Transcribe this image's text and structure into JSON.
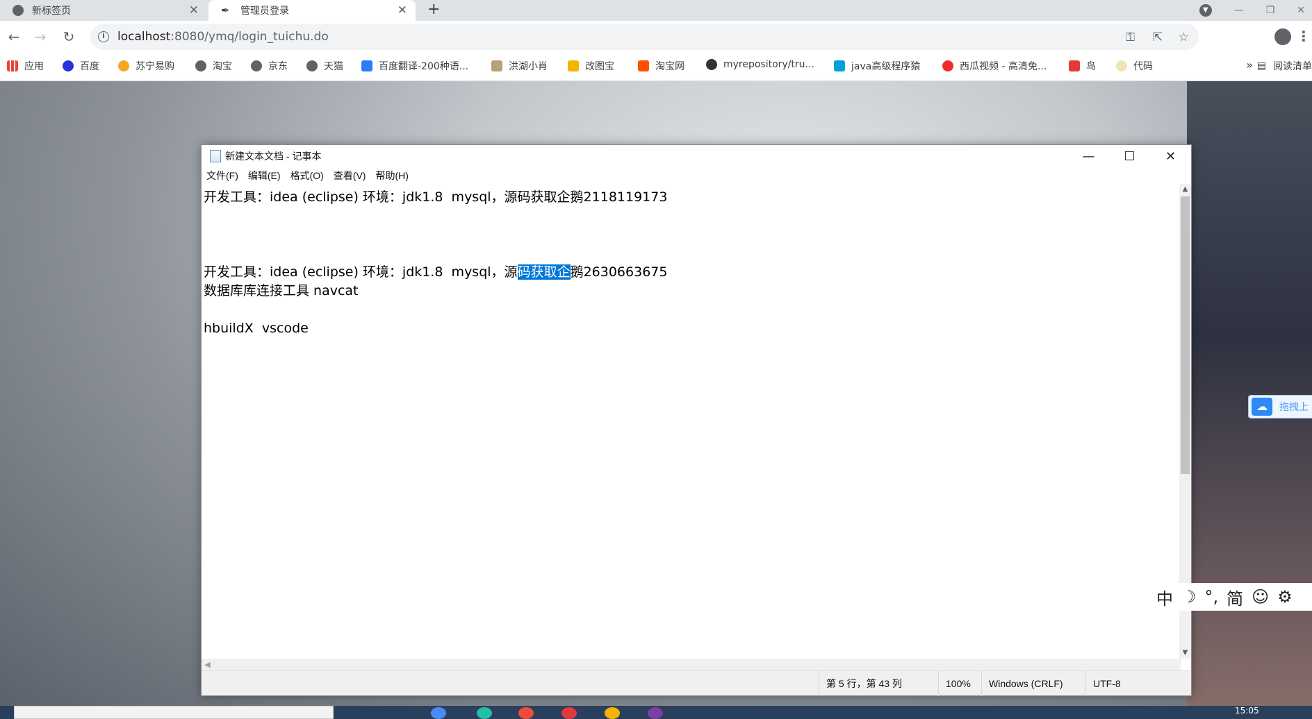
{
  "browser": {
    "tabs": [
      {
        "title": "新标签页",
        "active": false
      },
      {
        "title": "管理员登录",
        "active": true
      }
    ],
    "new_tab_label": "+",
    "url_host": "localhost",
    "url_rest": ":8080/ymq/login_tuichu.do",
    "bookmarks": [
      {
        "label": "应用",
        "icon": "apps-grid-icon",
        "color": "#1a73e8"
      },
      {
        "label": "百度",
        "icon": "baidu-paw-icon",
        "color": "#2932e1"
      },
      {
        "label": "苏宁易购",
        "icon": "suning-icon",
        "color": "#f5a623"
      },
      {
        "label": "淘宝",
        "icon": "globe-icon",
        "color": "#5f6368"
      },
      {
        "label": "京东",
        "icon": "globe-icon",
        "color": "#5f6368"
      },
      {
        "label": "天猫",
        "icon": "globe-icon",
        "color": "#5f6368"
      },
      {
        "label": "百度翻译-200种语...",
        "icon": "baidu-translate-icon",
        "color": "#2b7cf6"
      },
      {
        "label": "洪湖小肖",
        "icon": "feather-icon",
        "color": "#8a6d3b"
      },
      {
        "label": "改图宝",
        "icon": "folder-icon",
        "color": "#f4b400"
      },
      {
        "label": "淘宝网",
        "icon": "taobao-icon",
        "color": "#ff5000"
      },
      {
        "label": "myrepository/tru...",
        "icon": "github-icon",
        "color": "#333333"
      },
      {
        "label": "java高级程序猿",
        "icon": "bilibili-icon",
        "color": "#00a1d6"
      },
      {
        "label": "西瓜视频 - 高清免...",
        "icon": "xigua-icon",
        "color": "#f02d2d"
      },
      {
        "label": "鸟",
        "icon": "bird-icon",
        "color": "#e53935"
      },
      {
        "label": "代码",
        "icon": "circle-icon",
        "color": "#f0e6b0"
      }
    ],
    "bookmarks_more": "»",
    "reading_list": "阅读清单"
  },
  "notepad": {
    "title": "新建文本文档 - 记事本",
    "menu": [
      "文件(F)",
      "编辑(E)",
      "格式(O)",
      "查看(V)",
      "帮助(H)"
    ],
    "lines": [
      "开发工具：idea (eclipse) 环境：jdk1.8  mysql，源码获取企鹅2118119173",
      "",
      "",
      "",
      "开发工具：idea (eclipse) 环境：jdk1.8  mysql，源码获取企鹅2630663675",
      "数据库库连接工具 navcat",
      "",
      "hbuildX  vscode"
    ],
    "selected_line": {
      "before": "开发工具：idea (eclipse) 环境：jdk1.8  mysql，源",
      "selected": "码获取企",
      "after": "鹅2630663675"
    },
    "status": {
      "position": "第 5 行，第 43 列",
      "zoom": "100%",
      "line_ending": "Windows (CRLF)",
      "encoding": "UTF-8"
    }
  },
  "side_widget": {
    "label": "拖拽上"
  },
  "ime": [
    "中",
    "☽",
    "°,",
    "简",
    "☺",
    "⚙"
  ],
  "clock": "15:05",
  "colors": {
    "selection": "#0078d7",
    "chrome_tabstrip": "#dee1e6",
    "omnibox": "#f1f3f4"
  }
}
